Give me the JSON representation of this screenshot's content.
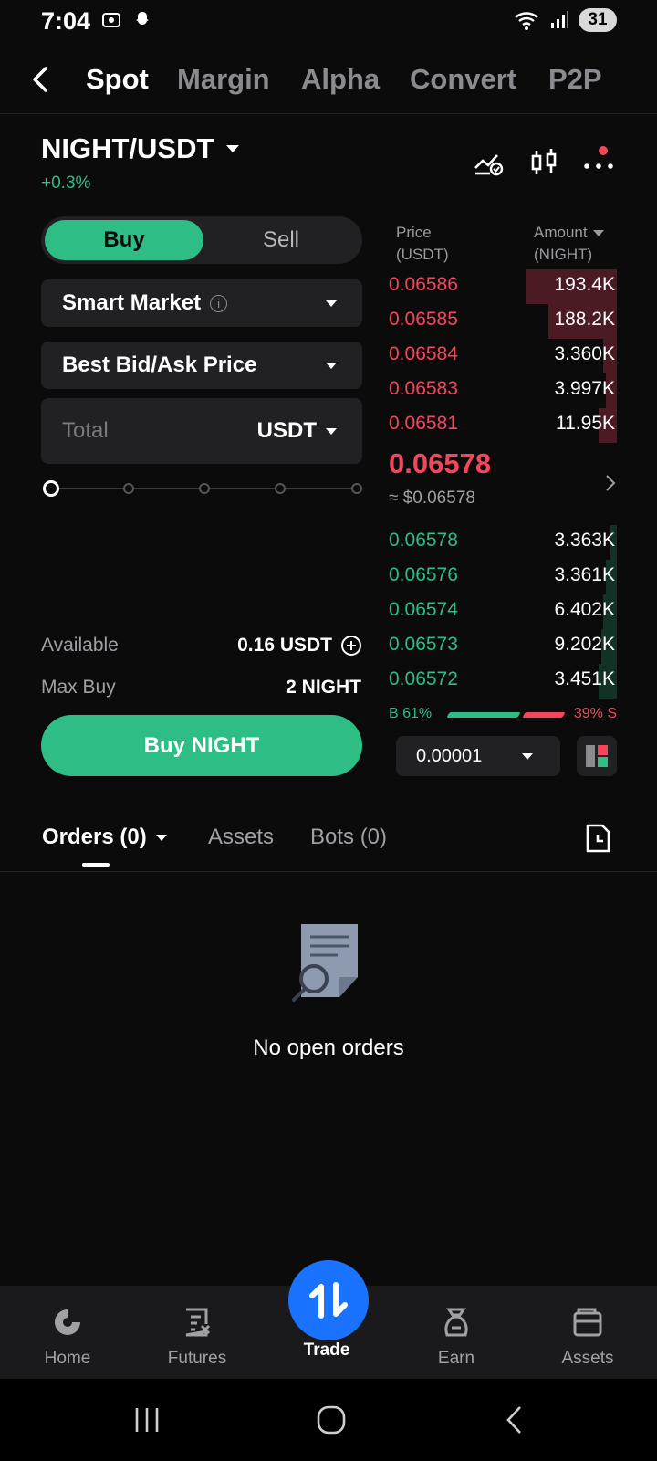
{
  "status_bar": {
    "time": "7:04",
    "battery": "31"
  },
  "top_tabs": [
    "Spot",
    "Margin",
    "Alpha",
    "Convert",
    "P2P"
  ],
  "pair": {
    "symbol": "NIGHT/USDT",
    "change": "+0.3%"
  },
  "order_form": {
    "buy_label": "Buy",
    "sell_label": "Sell",
    "order_type": "Smart Market",
    "price_mode": "Best Bid/Ask Price",
    "total_placeholder": "Total",
    "total_unit": "USDT",
    "slider_percent": 0,
    "available_label": "Available",
    "available_value": "0.16 USDT",
    "max_buy_label": "Max Buy",
    "max_buy_value": "2 NIGHT",
    "submit_label": "Buy NIGHT"
  },
  "order_book": {
    "price_header": "Price",
    "price_unit": "(USDT)",
    "amount_header": "Amount",
    "amount_unit": "(NIGHT)",
    "asks": [
      {
        "price": "0.06586",
        "amount": "193.4K",
        "depth": 0.4
      },
      {
        "price": "0.06585",
        "amount": "188.2K",
        "depth": 0.3
      },
      {
        "price": "0.06584",
        "amount": "3.360K",
        "depth": 0.06
      },
      {
        "price": "0.06583",
        "amount": "3.997K",
        "depth": 0.05
      },
      {
        "price": "0.06581",
        "amount": "11.95K",
        "depth": 0.08
      }
    ],
    "last_price": "0.06578",
    "last_price_usd": "≈ $0.06578",
    "bids": [
      {
        "price": "0.06578",
        "amount": "3.363K",
        "depth": 0.03
      },
      {
        "price": "0.06576",
        "amount": "3.361K",
        "depth": 0.05
      },
      {
        "price": "0.06574",
        "amount": "6.402K",
        "depth": 0.06
      },
      {
        "price": "0.06573",
        "amount": "9.202K",
        "depth": 0.07
      },
      {
        "price": "0.06572",
        "amount": "3.451K",
        "depth": 0.08
      }
    ],
    "buy_ratio": "B 61%",
    "sell_ratio": "39% S",
    "precision": "0.00001"
  },
  "orders_tabs": {
    "orders": "Orders (0)",
    "assets": "Assets",
    "bots": "Bots (0)"
  },
  "empty_state": "No open orders",
  "bottom_nav": [
    "Home",
    "Futures",
    "Trade",
    "Earn",
    "Assets"
  ],
  "colors": {
    "green": "#2ebd85",
    "red": "#f6465d",
    "blue": "#1a73ff",
    "background": "#0b0b0c"
  }
}
